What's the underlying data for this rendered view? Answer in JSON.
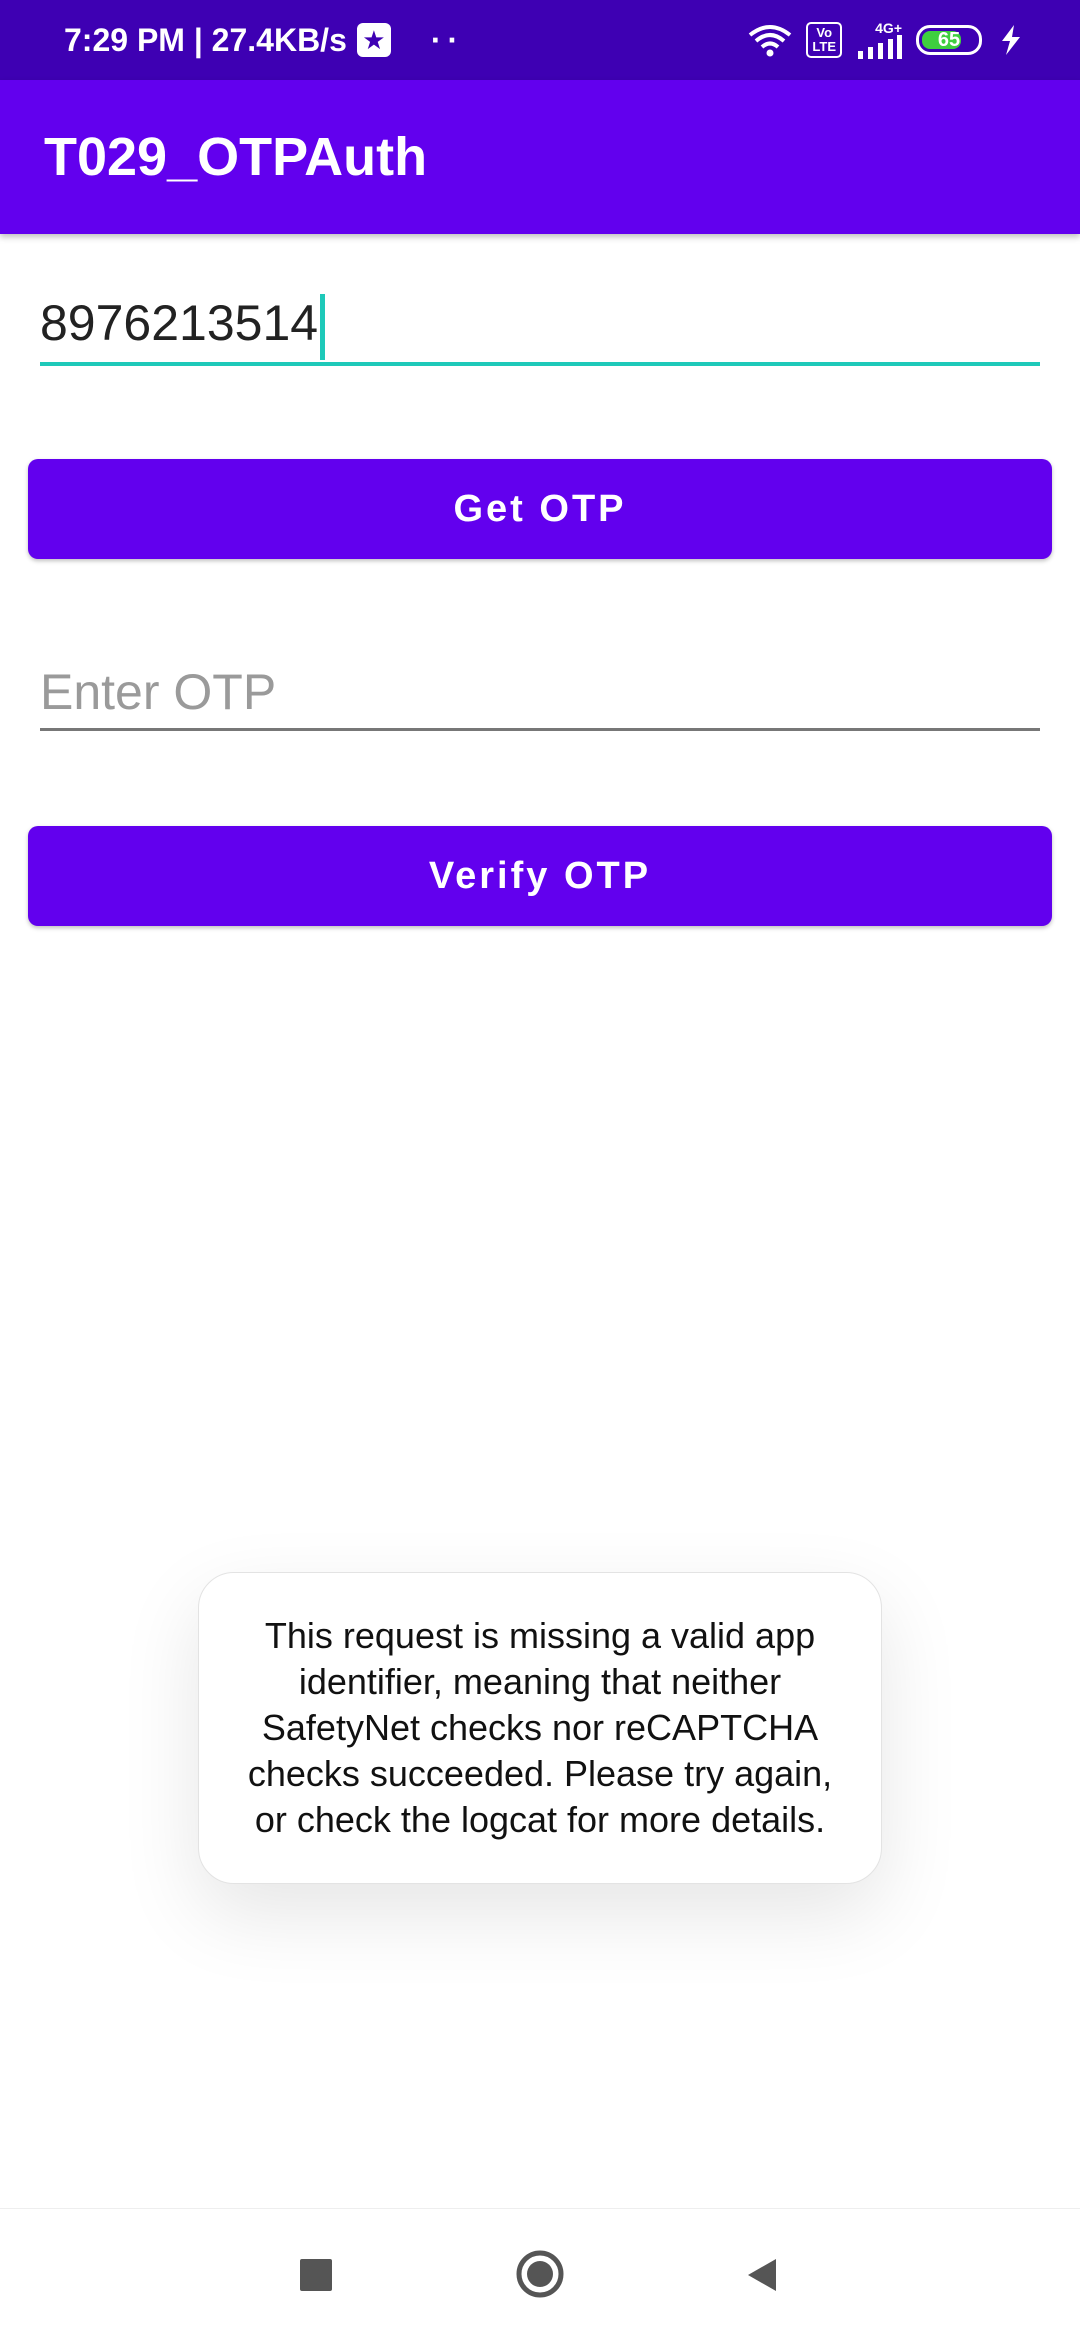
{
  "status_bar": {
    "time_speed": "7:29 PM | 27.4KB/s",
    "app_icon": "star-app-icon",
    "dots": "··",
    "volte_top": "Vo",
    "volte_bottom": "LTE",
    "network": "4G+",
    "battery": "65",
    "icons": [
      "wifi-icon",
      "volte-icon",
      "signal-icon",
      "battery-icon",
      "charging-icon"
    ]
  },
  "app_bar": {
    "title": "T029_OTPAuth"
  },
  "form": {
    "phone_value": "8976213514",
    "get_otp_label": "Get OTP",
    "otp_placeholder": "Enter OTP",
    "verify_otp_label": "Verify OTP"
  },
  "toast": {
    "message": "This request is missing a valid app identifier, meaning that neither SafetyNet checks nor reCAPTCHA checks succeeded. Please try again, or check the logcat for more details."
  },
  "nav_bar": {
    "icons": [
      "recents-icon",
      "home-icon",
      "back-icon"
    ]
  },
  "colors": {
    "primary": "#6200EE",
    "status_bar": "#3E00B3",
    "accent": "#1EC9B9"
  }
}
